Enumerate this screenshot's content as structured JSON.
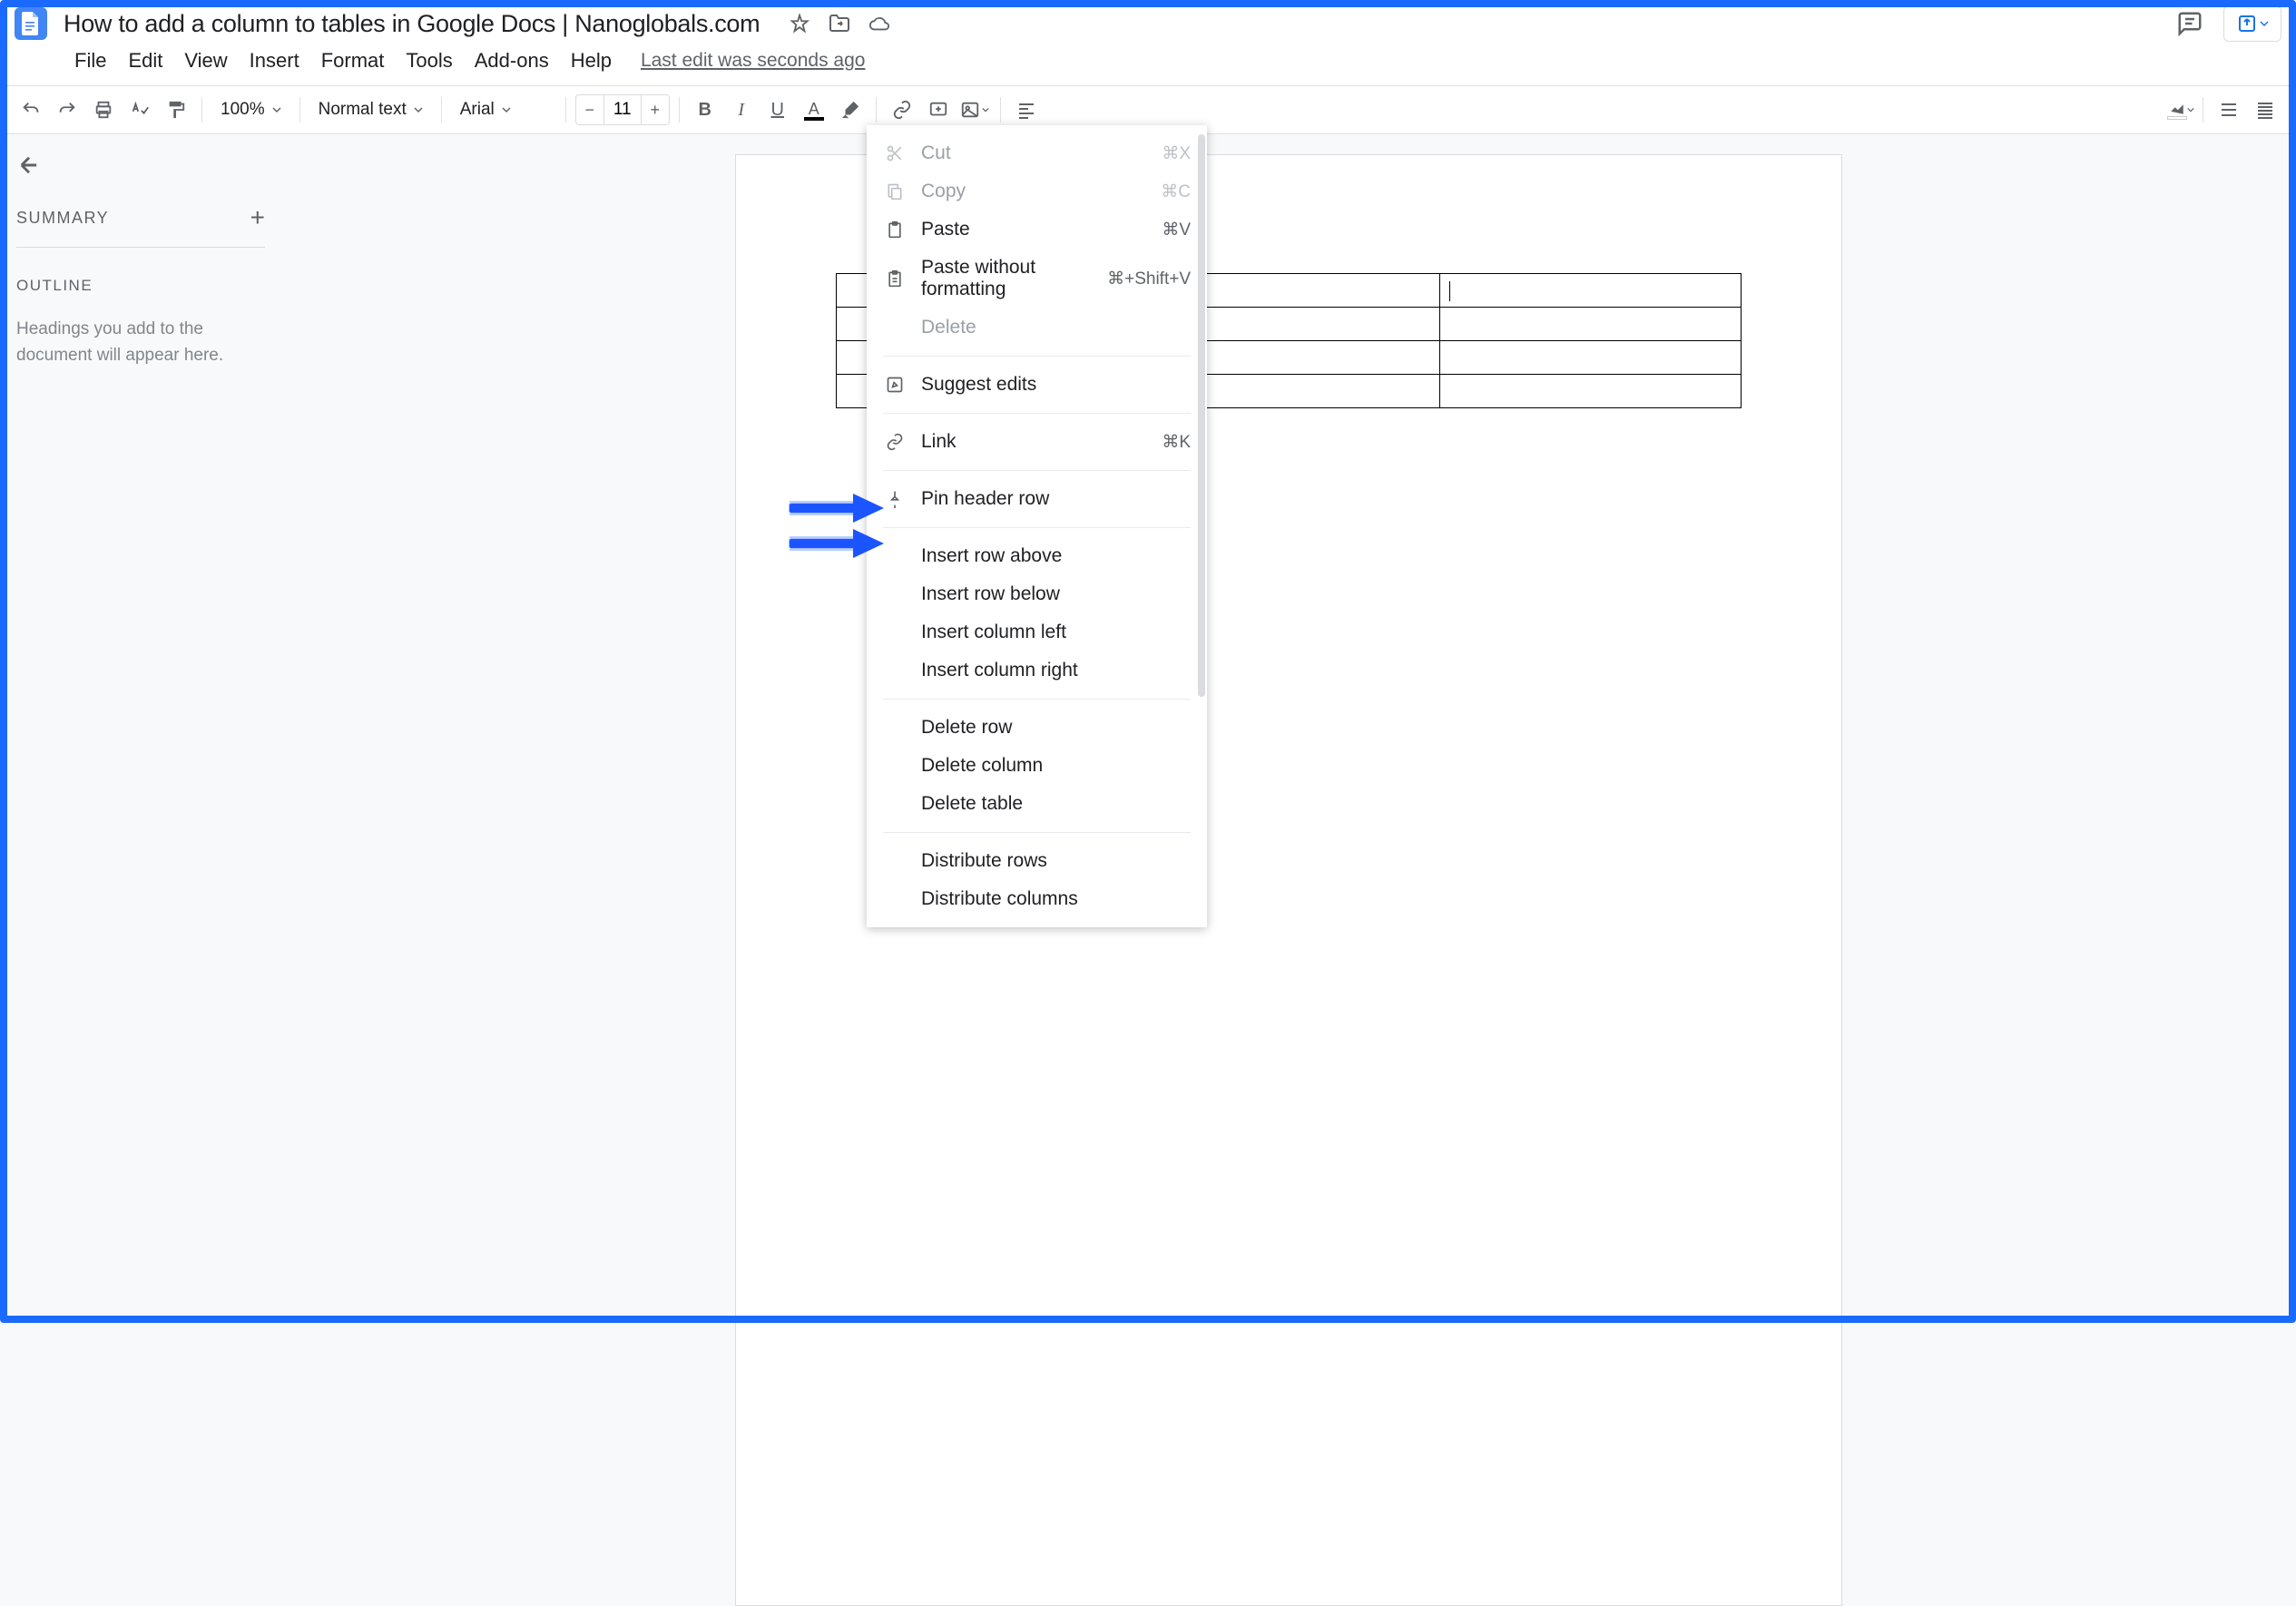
{
  "doc_title": "How to add a column to tables in Google Docs | Nanoglobals.com",
  "menus": [
    "File",
    "Edit",
    "View",
    "Insert",
    "Format",
    "Tools",
    "Add-ons",
    "Help"
  ],
  "last_edit": "Last edit was seconds ago",
  "toolbar": {
    "zoom": "100%",
    "style": "Normal text",
    "font": "Arial",
    "size": "11"
  },
  "sidebar": {
    "summary": "SUMMARY",
    "outline": "OUTLINE",
    "hint": "Headings you add to the document will appear here."
  },
  "ctx": {
    "cut": "Cut",
    "cut_k": "⌘X",
    "copy": "Copy",
    "copy_k": "⌘C",
    "paste": "Paste",
    "paste_k": "⌘V",
    "paste_wf": "Paste without formatting",
    "paste_wf_k": "⌘+Shift+V",
    "delete": "Delete",
    "suggest": "Suggest edits",
    "link": "Link",
    "link_k": "⌘K",
    "pin": "Pin header row",
    "irow_a": "Insert row above",
    "irow_b": "Insert row below",
    "icol_l": "Insert column left",
    "icol_r": "Insert column right",
    "drow": "Delete row",
    "dcol": "Delete column",
    "dtable": "Delete table",
    "dist_r": "Distribute rows",
    "dist_c": "Distribute columns"
  }
}
